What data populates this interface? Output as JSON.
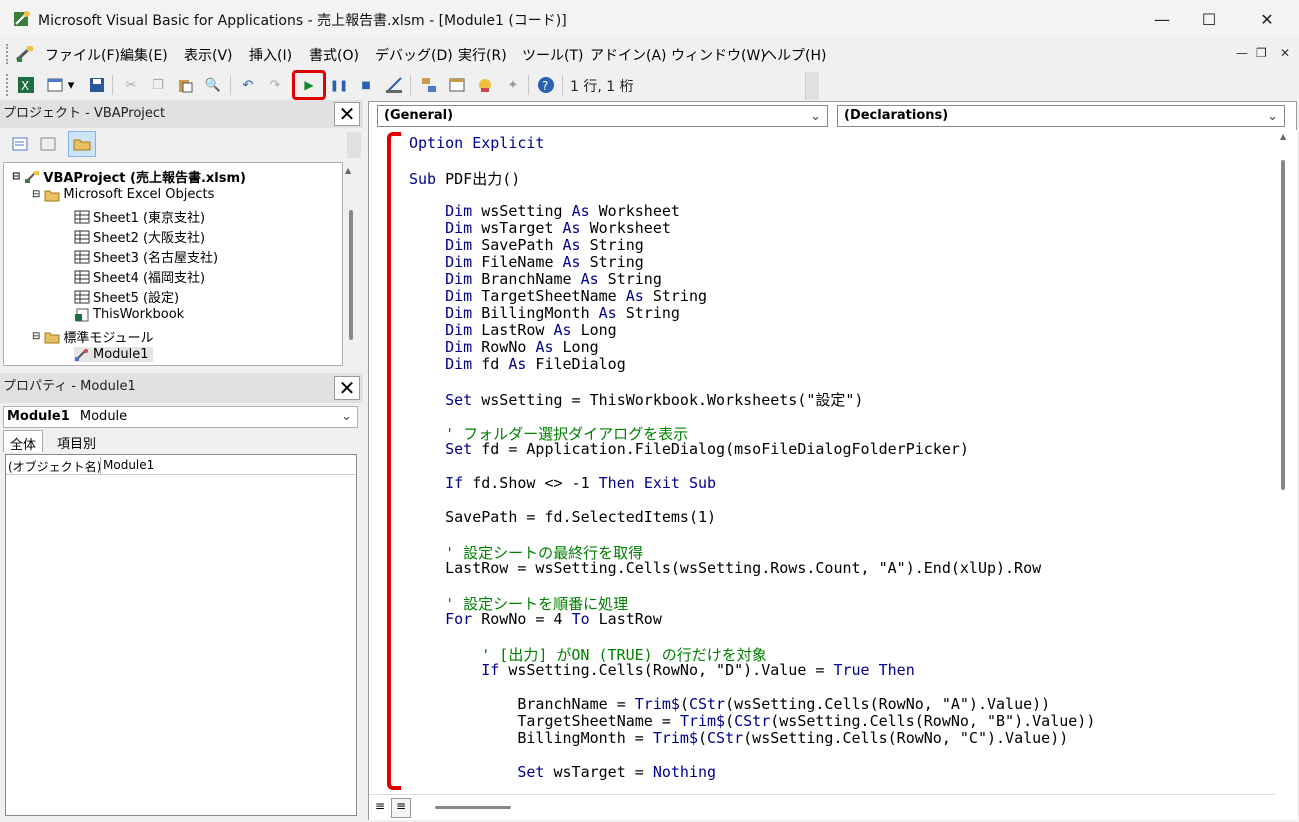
{
  "window": {
    "title": "Microsoft Visual Basic for Applications - 売上報告書.xlsm - [Module1 (コード)]"
  },
  "menu": {
    "items": [
      "ファイル(F)",
      "編集(E)",
      "表示(V)",
      "挿入(I)",
      "書式(O)",
      "デバッグ(D)",
      "実行(R)",
      "ツール(T)",
      "アドイン(A)",
      "ウィンドウ(W)",
      "ヘルプ(H)"
    ]
  },
  "toolbar": {
    "position_text": "1 行, 1 桁"
  },
  "project": {
    "title": "プロジェクト - VBAProject",
    "root": "VBAProject (売上報告書.xlsm)",
    "objects_folder": "Microsoft Excel Objects",
    "sheets": [
      "Sheet1 (東京支社)",
      "Sheet2 (大阪支社)",
      "Sheet3 (名古屋支社)",
      "Sheet4 (福岡支社)",
      "Sheet5 (設定)"
    ],
    "workbook": "ThisWorkbook",
    "modules_folder": "標準モジュール",
    "module": "Module1"
  },
  "properties": {
    "title": "プロパティ - Module1",
    "object_name": "Module1",
    "object_type": "Module",
    "tab_all": "全体",
    "tab_category": "項目別",
    "row_name": "(オブジェクト名)",
    "row_value": "Module1"
  },
  "code": {
    "general_combo": "(General)",
    "declarations_combo": "(Declarations)",
    "lines": [
      {
        "t": "Option Explicit",
        "type": "kw"
      },
      {
        "t": "",
        "type": "plain"
      },
      {
        "t": "Sub PDF出力()",
        "type": "plain"
      },
      {
        "t": "",
        "type": "plain"
      },
      {
        "t": "    Dim wsSetting As Worksheet",
        "type": "plain"
      },
      {
        "t": "    Dim wsTarget As Worksheet",
        "type": "plain"
      },
      {
        "t": "    Dim SavePath As String",
        "type": "plain"
      },
      {
        "t": "    Dim FileName As String",
        "type": "plain"
      },
      {
        "t": "    Dim BranchName As String",
        "type": "plain"
      },
      {
        "t": "    Dim TargetSheetName As String",
        "type": "plain"
      },
      {
        "t": "    Dim BillingMonth As String",
        "type": "plain"
      },
      {
        "t": "    Dim LastRow As Long",
        "type": "plain"
      },
      {
        "t": "    Dim RowNo As Long",
        "type": "plain"
      },
      {
        "t": "    Dim fd As FileDialog",
        "type": "plain"
      },
      {
        "t": "",
        "type": "plain"
      },
      {
        "t": "    Set wsSetting = ThisWorkbook.Worksheets(\"設定\")",
        "type": "plain"
      },
      {
        "t": "",
        "type": "plain"
      },
      {
        "t": "    ' フォルダー選択ダイアログを表示",
        "type": "cm"
      },
      {
        "t": "    Set fd = Application.FileDialog(msoFileDialogFolderPicker)",
        "type": "plain"
      },
      {
        "t": "",
        "type": "plain"
      },
      {
        "t": "    If fd.Show <> -1 Then Exit Sub",
        "type": "plain"
      },
      {
        "t": "",
        "type": "plain"
      },
      {
        "t": "    SavePath = fd.SelectedItems(1)",
        "type": "plain"
      },
      {
        "t": "",
        "type": "plain"
      },
      {
        "t": "    ' 設定シートの最終行を取得",
        "type": "cm"
      },
      {
        "t": "    LastRow = wsSetting.Cells(wsSetting.Rows.Count, \"A\").End(xlUp).Row",
        "type": "plain"
      },
      {
        "t": "",
        "type": "plain"
      },
      {
        "t": "    ' 設定シートを順番に処理",
        "type": "cm"
      },
      {
        "t": "    For RowNo = 4 To LastRow",
        "type": "plain"
      },
      {
        "t": "",
        "type": "plain"
      },
      {
        "t": "        ' [出力] がON (TRUE) の行だけを対象",
        "type": "cm"
      },
      {
        "t": "        If wsSetting.Cells(RowNo, \"D\").Value = True Then",
        "type": "plain"
      },
      {
        "t": "",
        "type": "plain"
      },
      {
        "t": "            BranchName = Trim$(CStr(wsSetting.Cells(RowNo, \"A\").Value))",
        "type": "plain"
      },
      {
        "t": "            TargetSheetName = Trim$(CStr(wsSetting.Cells(RowNo, \"B\").Value))",
        "type": "plain"
      },
      {
        "t": "            BillingMonth = Trim$(CStr(wsSetting.Cells(RowNo, \"C\").Value))",
        "type": "plain"
      },
      {
        "t": "",
        "type": "plain"
      },
      {
        "t": "            Set wsTarget = Nothing",
        "type": "plain"
      }
    ]
  }
}
